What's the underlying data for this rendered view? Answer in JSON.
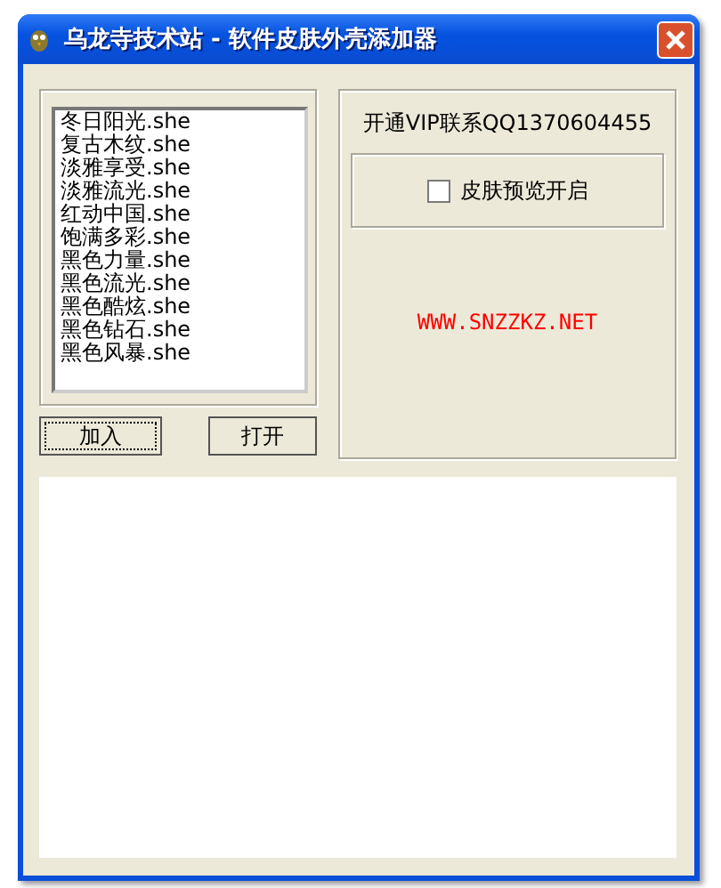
{
  "window": {
    "title": "乌龙寺技术站 - 软件皮肤外壳添加器"
  },
  "skin_list": {
    "items": [
      {
        "label": "冬日阳光.she",
        "selected": false
      },
      {
        "label": "复古木纹.she",
        "selected": false
      },
      {
        "label": "淡雅享受.she",
        "selected": false
      },
      {
        "label": "淡雅流光.she",
        "selected": false
      },
      {
        "label": "红动中国.she",
        "selected": false
      },
      {
        "label": "饱满多彩.she",
        "selected": false
      },
      {
        "label": "黑色力量.she",
        "selected": false
      },
      {
        "label": "黑色流光.she",
        "selected": false
      },
      {
        "label": "黑色酷炫.she",
        "selected": false
      },
      {
        "label": "黑色钻石.she",
        "selected": false
      },
      {
        "label": "黑色风暴.she",
        "selected": false
      }
    ]
  },
  "buttons": [
    {
      "label": "加入",
      "focused": true
    },
    {
      "label": "打开",
      "focused": false
    }
  ],
  "vip_text": "开通VIP联系QQ1370604455",
  "preview_checkbox": {
    "label": "皮肤预览开启",
    "checked": false
  },
  "website": "WWW.SNZZKZ.NET"
}
